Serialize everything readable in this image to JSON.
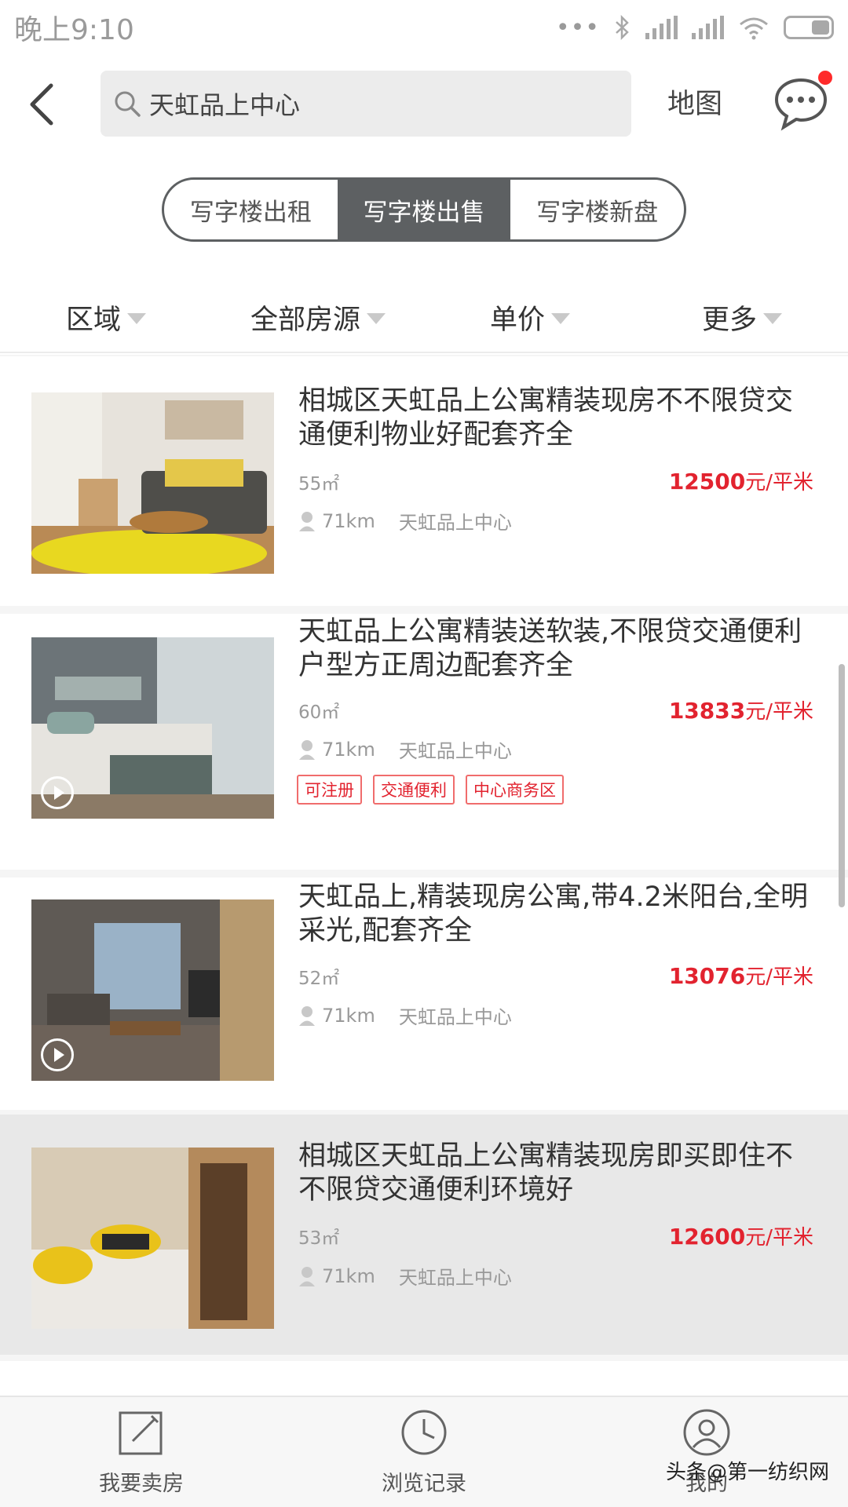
{
  "status_bar": {
    "time": "晚上9:10",
    "more": "•••"
  },
  "header": {
    "search_text": "天虹品上中心",
    "map_label": "地图"
  },
  "segment": {
    "tabs": [
      "写字楼出租",
      "写字楼出售",
      "写字楼新盘"
    ],
    "active": 1
  },
  "filters": [
    {
      "label": "区域"
    },
    {
      "label": "全部房源"
    },
    {
      "label": "单价"
    },
    {
      "label": "更多"
    }
  ],
  "listings": [
    {
      "title": "相城区天虹品上公寓精装现房不不限贷交通便利物业好配套齐全",
      "area": "55㎡",
      "price_value": "12500",
      "price_unit": "元/平米",
      "distance": "71km",
      "location": "天虹品上中心",
      "tags": [],
      "video": false
    },
    {
      "title": "天虹品上公寓精装送软装,不限贷交通便利户型方正周边配套齐全",
      "area": "60㎡",
      "price_value": "13833",
      "price_unit": "元/平米",
      "distance": "71km",
      "location": "天虹品上中心",
      "tags": [
        "可注册",
        "交通便利",
        "中心商务区"
      ],
      "video": true
    },
    {
      "title": "天虹品上,精装现房公寓,带4.2米阳台,全明采光,配套齐全",
      "area": "52㎡",
      "price_value": "13076",
      "price_unit": "元/平米",
      "distance": "71km",
      "location": "天虹品上中心",
      "tags": [],
      "video": true
    },
    {
      "title": "相城区天虹品上公寓精装现房即买即住不不限贷交通便利环境好",
      "area": "53㎡",
      "price_value": "12600",
      "price_unit": "元/平米",
      "distance": "71km",
      "location": "天虹品上中心",
      "tags": [],
      "video": false
    }
  ],
  "bottom_nav": [
    {
      "label": "我要卖房",
      "icon": "edit-icon"
    },
    {
      "label": "浏览记录",
      "icon": "clock-icon"
    },
    {
      "label": "我的",
      "icon": "user-icon"
    }
  ],
  "watermark": "头条@第一纺织网",
  "colors": {
    "accent_red": "#e2232f",
    "segment_dark": "#5d6062"
  }
}
